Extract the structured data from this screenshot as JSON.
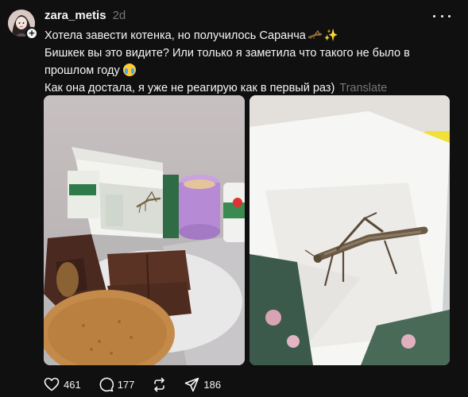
{
  "post": {
    "username": "zara_metis",
    "timestamp": "2d",
    "lines": [
      "Хотела завести котенка, но получилось Саранча",
      "Бишкек вы это видите? Или только я заметила что такого не было в",
      "прошлом году",
      "Как она достала, я уже не реагирую как в первый раз)"
    ],
    "translate_label": "Translate",
    "images": [
      "photo-locust-on-milk-carton",
      "photo-locust-on-napkin"
    ]
  },
  "actions": {
    "likes": "461",
    "replies": "177",
    "shares": "186"
  },
  "icons": [
    "plus-icon",
    "more-icon",
    "heart-icon",
    "comment-icon",
    "repost-icon",
    "send-icon"
  ],
  "colors": {
    "background": "#101010",
    "text": "#f3f5f7",
    "muted": "#777777"
  }
}
